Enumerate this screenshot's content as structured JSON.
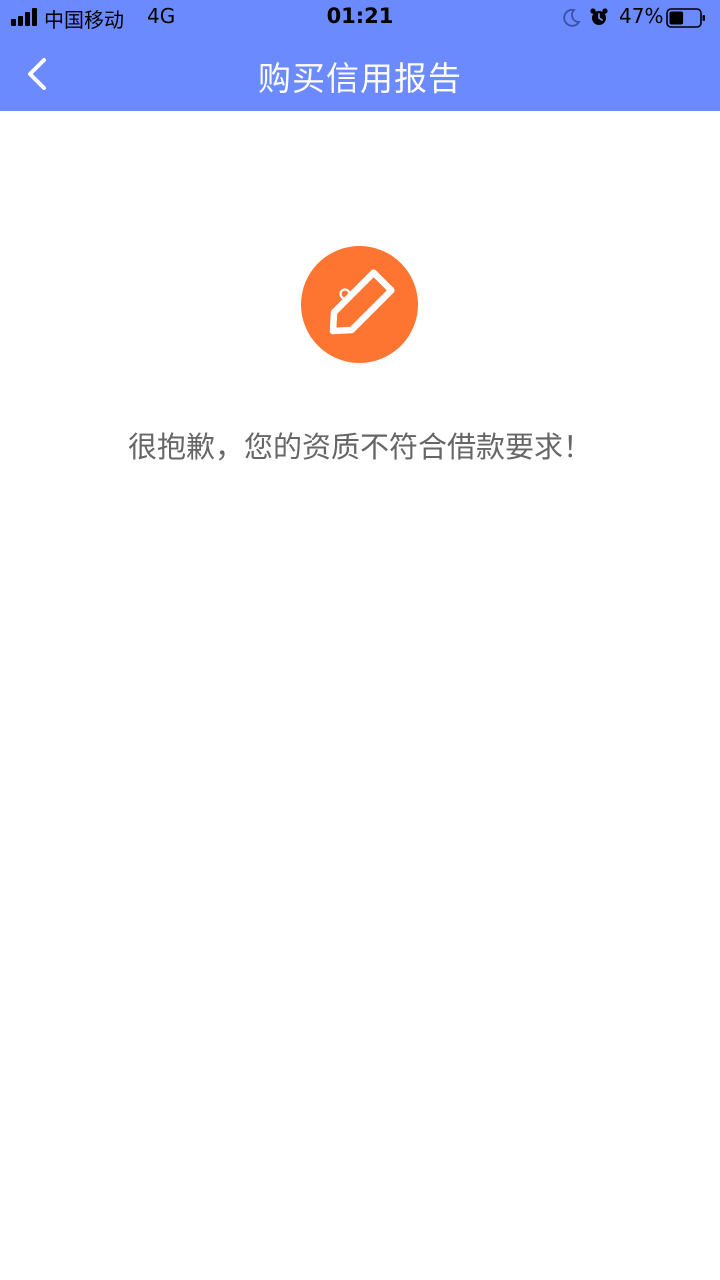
{
  "status_bar": {
    "carrier": "中国移动",
    "network": "4G",
    "time": "01:21",
    "battery_percent": "47%",
    "battery_level": 0.47,
    "icons": [
      "signal-icon",
      "moon-icon",
      "alarm-icon",
      "battery-icon"
    ]
  },
  "nav": {
    "title": "购买信用报告",
    "back_icon": "chevron-left-icon"
  },
  "content": {
    "icon": "price-tag-icon",
    "message": "很抱歉，您的资质不符合借款要求！"
  },
  "colors": {
    "header_bg": "#6b8afd",
    "badge_bg": "#fd7530",
    "message_text": "#666666"
  }
}
